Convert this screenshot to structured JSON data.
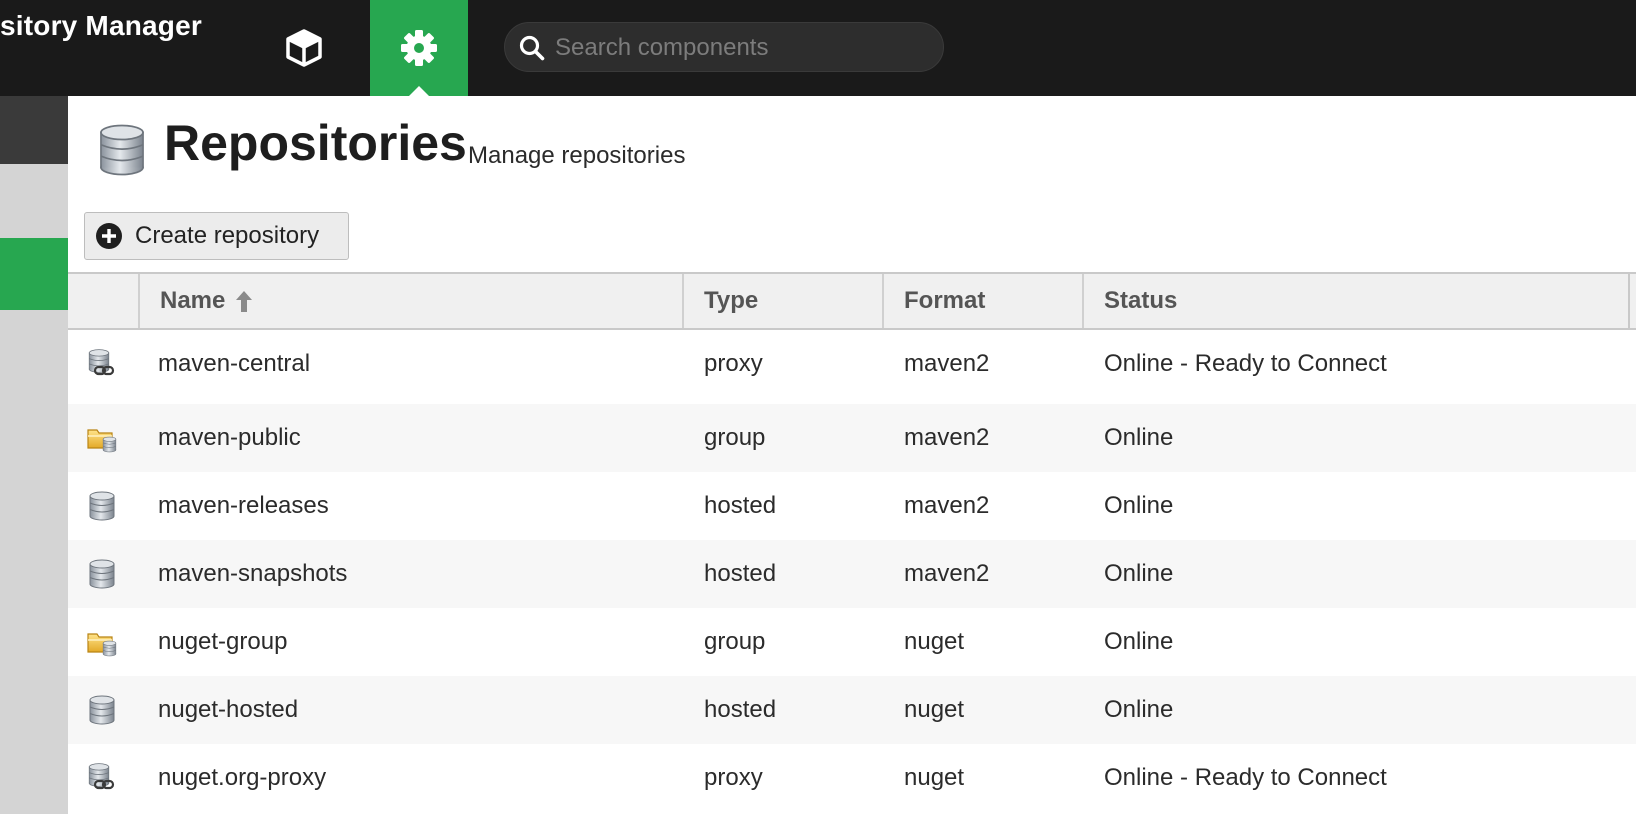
{
  "header": {
    "title": "sitory Manager",
    "search": {
      "placeholder": "Search components"
    },
    "icons": {
      "browse": "cube-icon",
      "admin": "gear-icon",
      "search": "search-icon"
    }
  },
  "page": {
    "title": "Repositories",
    "subtitle": "Manage repositories",
    "create_label": "Create repository"
  },
  "columns": {
    "name": "Name",
    "type": "Type",
    "format": "Format",
    "status": "Status",
    "sort": "ascending"
  },
  "rows": [
    {
      "icon": "proxy-repo-icon",
      "name": "maven-central",
      "type": "proxy",
      "format": "maven2",
      "status": "Online - Ready to Connect"
    },
    {
      "icon": "group-repo-icon",
      "name": "maven-public",
      "type": "group",
      "format": "maven2",
      "status": "Online"
    },
    {
      "icon": "hosted-repo-icon",
      "name": "maven-releases",
      "type": "hosted",
      "format": "maven2",
      "status": "Online"
    },
    {
      "icon": "hosted-repo-icon",
      "name": "maven-snapshots",
      "type": "hosted",
      "format": "maven2",
      "status": "Online"
    },
    {
      "icon": "group-repo-icon",
      "name": "nuget-group",
      "type": "group",
      "format": "nuget",
      "status": "Online"
    },
    {
      "icon": "hosted-repo-icon",
      "name": "nuget-hosted",
      "type": "hosted",
      "format": "nuget",
      "status": "Online"
    },
    {
      "icon": "proxy-repo-icon",
      "name": "nuget.org-proxy",
      "type": "proxy",
      "format": "nuget",
      "status": "Online - Ready to Connect"
    }
  ],
  "colors": {
    "topbar": "#1a1a1a",
    "accent": "#27a750",
    "panel": "#ffffff",
    "sidebar": "#d4d4d4"
  }
}
